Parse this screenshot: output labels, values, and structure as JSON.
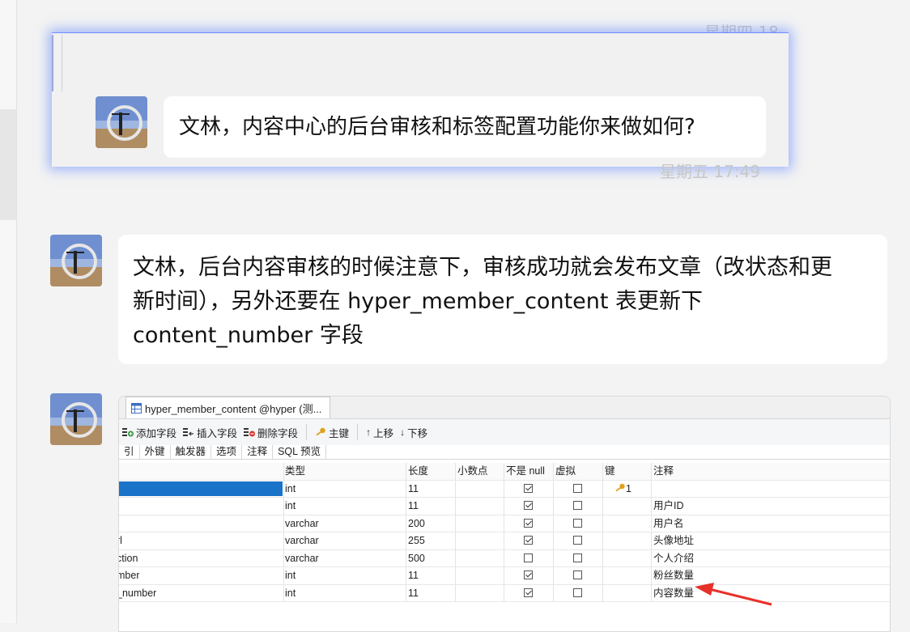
{
  "timestamps": {
    "top": "星期四 18",
    "middle": "星期五 17:49"
  },
  "quoted_message": {
    "text": "文林，内容中心的后台审核和标签配置功能你来做如何?"
  },
  "message": {
    "text": "文林，后台内容审核的时候注意下，审核成功就会发布文章（改状态和更\n新时间），另外还要在 hyper_member_content 表更新下\ncontent_number 字段"
  },
  "db_window": {
    "tab_title": "hyper_member_content @hyper (测...",
    "toolbar": {
      "add_field": "添加字段",
      "insert_field": "插入字段",
      "delete_field": "删除字段",
      "primary_key": "主键",
      "move_up": "上移",
      "move_down": "下移"
    },
    "subtabs": [
      "引",
      "外键",
      "触发器",
      "选项",
      "注释",
      "SQL 预览"
    ],
    "columns": [
      "类型",
      "长度",
      "小数点",
      "不是 null",
      "虚拟",
      "键",
      "注释"
    ],
    "rows": [
      {
        "name": "",
        "type": "int",
        "length": "11",
        "not_null": true,
        "virtual": false,
        "key": "1",
        "comment": ""
      },
      {
        "name": "",
        "type": "int",
        "length": "11",
        "not_null": true,
        "virtual": false,
        "key": "",
        "comment": "用户ID"
      },
      {
        "name": "",
        "type": "varchar",
        "length": "200",
        "not_null": true,
        "virtual": false,
        "key": "",
        "comment": "用户名"
      },
      {
        "name": "rl",
        "type": "varchar",
        "length": "255",
        "not_null": true,
        "virtual": false,
        "key": "",
        "comment": "头像地址"
      },
      {
        "name": "ction",
        "type": "varchar",
        "length": "500",
        "not_null": false,
        "virtual": false,
        "key": "",
        "comment": "个人介绍"
      },
      {
        "name": "mber",
        "type": "int",
        "length": "11",
        "not_null": true,
        "virtual": false,
        "key": "",
        "comment": "粉丝数量"
      },
      {
        "name": "_number",
        "type": "int",
        "length": "11",
        "not_null": true,
        "virtual": false,
        "key": "",
        "comment": "内容数量"
      }
    ]
  },
  "colors": {
    "highlight_glow": "#6e8cff",
    "selected_cell": "#1a73c9",
    "arrow": "#e8302a"
  }
}
